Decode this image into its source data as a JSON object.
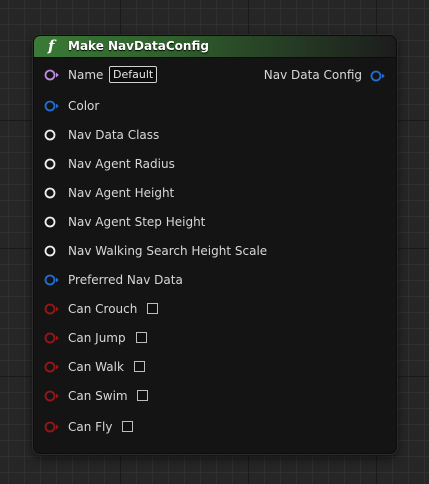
{
  "node": {
    "title": "Make NavDataConfig",
    "icon": "function-icon",
    "header_color": "#3a7a36",
    "name_label": "Name",
    "name_value": "Default",
    "output_label": "Nav Data Config",
    "pins": [
      {
        "label": "Color"
      },
      {
        "label": "Nav Data Class"
      },
      {
        "label": "Nav Agent Radius"
      },
      {
        "label": "Nav Agent Height"
      },
      {
        "label": "Nav Agent Step Height"
      },
      {
        "label": "Nav Walking Search Height Scale"
      },
      {
        "label": "Preferred Nav Data"
      },
      {
        "label": "Can Crouch",
        "checked": false
      },
      {
        "label": "Can Jump",
        "checked": false
      },
      {
        "label": "Can Walk",
        "checked": false
      },
      {
        "label": "Can Swim",
        "checked": false
      },
      {
        "label": "Can Fly",
        "checked": false
      }
    ]
  },
  "colors": {
    "name_pin": "#c28be0",
    "struct_pin": "#1f6fd4",
    "white_pin": "#f0f0f0",
    "bool_pin": "#9a1616"
  }
}
